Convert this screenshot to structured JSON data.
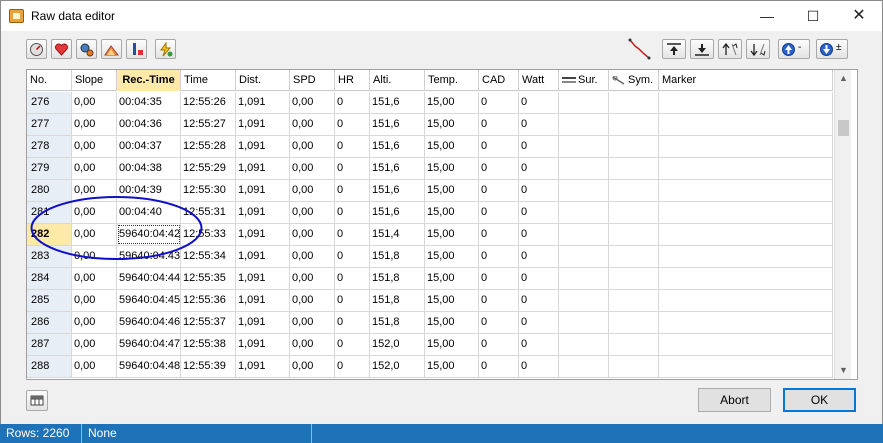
{
  "window": {
    "title": "Raw data editor",
    "min": "—",
    "max": "☐",
    "close": "✕"
  },
  "toolbar": {
    "left_icons": [
      "speedometer-icon",
      "heart-icon",
      "gears-icon",
      "cadence-icon",
      "warning-temp-icon",
      "lightning-icon"
    ],
    "right_icons": [
      "track-line-icon",
      "row-top-icon",
      "row-bottom-icon",
      "sort-up-icon",
      "sort-down-icon",
      "blue-up-icon",
      "blue-down-icon"
    ],
    "up_suffix": "-",
    "down_suffix": "±"
  },
  "columns": [
    "No.",
    "Slope",
    "Rec.-Time",
    "Time",
    "Dist.",
    "SPD",
    "HR",
    "Alti.",
    "Temp.",
    "CAD",
    "Watt",
    "Sur.",
    "Sym.",
    "Marker"
  ],
  "sorted_column": "Rec.-Time",
  "rows": [
    {
      "no": "276",
      "slope": "0,00",
      "rec": "00:04:35",
      "time": "12:55:26",
      "dist": "1,091",
      "spd": "0,00",
      "hr": "0",
      "alti": "151,6",
      "temp": "15,00",
      "cad": "0",
      "watt": "0"
    },
    {
      "no": "277",
      "slope": "0,00",
      "rec": "00:04:36",
      "time": "12:55:27",
      "dist": "1,091",
      "spd": "0,00",
      "hr": "0",
      "alti": "151,6",
      "temp": "15,00",
      "cad": "0",
      "watt": "0"
    },
    {
      "no": "278",
      "slope": "0,00",
      "rec": "00:04:37",
      "time": "12:55:28",
      "dist": "1,091",
      "spd": "0,00",
      "hr": "0",
      "alti": "151,6",
      "temp": "15,00",
      "cad": "0",
      "watt": "0"
    },
    {
      "no": "279",
      "slope": "0,00",
      "rec": "00:04:38",
      "time": "12:55:29",
      "dist": "1,091",
      "spd": "0,00",
      "hr": "0",
      "alti": "151,6",
      "temp": "15,00",
      "cad": "0",
      "watt": "0"
    },
    {
      "no": "280",
      "slope": "0,00",
      "rec": "00:04:39",
      "time": "12:55:30",
      "dist": "1,091",
      "spd": "0,00",
      "hr": "0",
      "alti": "151,6",
      "temp": "15,00",
      "cad": "0",
      "watt": "0"
    },
    {
      "no": "281",
      "slope": "0,00",
      "rec": "00:04:40",
      "time": "12:55:31",
      "dist": "1,091",
      "spd": "0,00",
      "hr": "0",
      "alti": "151,6",
      "temp": "15,00",
      "cad": "0",
      "watt": "0"
    },
    {
      "no": "282",
      "slope": "0,00",
      "rec": "59640:04:42",
      "time": "12:55:33",
      "dist": "1,091",
      "spd": "0,00",
      "hr": "0",
      "alti": "151,4",
      "temp": "15,00",
      "cad": "0",
      "watt": "0"
    },
    {
      "no": "283",
      "slope": "0,00",
      "rec": "59640:04:43",
      "time": "12:55:34",
      "dist": "1,091",
      "spd": "0,00",
      "hr": "0",
      "alti": "151,8",
      "temp": "15,00",
      "cad": "0",
      "watt": "0"
    },
    {
      "no": "284",
      "slope": "0,00",
      "rec": "59640:04:44",
      "time": "12:55:35",
      "dist": "1,091",
      "spd": "0,00",
      "hr": "0",
      "alti": "151,8",
      "temp": "15,00",
      "cad": "0",
      "watt": "0"
    },
    {
      "no": "285",
      "slope": "0,00",
      "rec": "59640:04:45",
      "time": "12:55:36",
      "dist": "1,091",
      "spd": "0,00",
      "hr": "0",
      "alti": "151,8",
      "temp": "15,00",
      "cad": "0",
      "watt": "0"
    },
    {
      "no": "286",
      "slope": "0,00",
      "rec": "59640:04:46",
      "time": "12:55:37",
      "dist": "1,091",
      "spd": "0,00",
      "hr": "0",
      "alti": "151,8",
      "temp": "15,00",
      "cad": "0",
      "watt": "0"
    },
    {
      "no": "287",
      "slope": "0,00",
      "rec": "59640:04:47",
      "time": "12:55:38",
      "dist": "1,091",
      "spd": "0,00",
      "hr": "0",
      "alti": "152,0",
      "temp": "15,00",
      "cad": "0",
      "watt": "0"
    },
    {
      "no": "288",
      "slope": "0,00",
      "rec": "59640:04:48",
      "time": "12:55:39",
      "dist": "1,091",
      "spd": "0,00",
      "hr": "0",
      "alti": "152,0",
      "temp": "15,00",
      "cad": "0",
      "watt": "0"
    }
  ],
  "active_row": "282",
  "scroll": {
    "up": "▲",
    "down": "▼"
  },
  "buttons": {
    "abort": "Abort",
    "ok": "OK"
  },
  "status": {
    "rows": "Rows: 2260",
    "info": "None"
  },
  "colors": {
    "annotation": "#1010c8",
    "status_bar": "#1e72b8",
    "highlight": "#fde9a8"
  }
}
